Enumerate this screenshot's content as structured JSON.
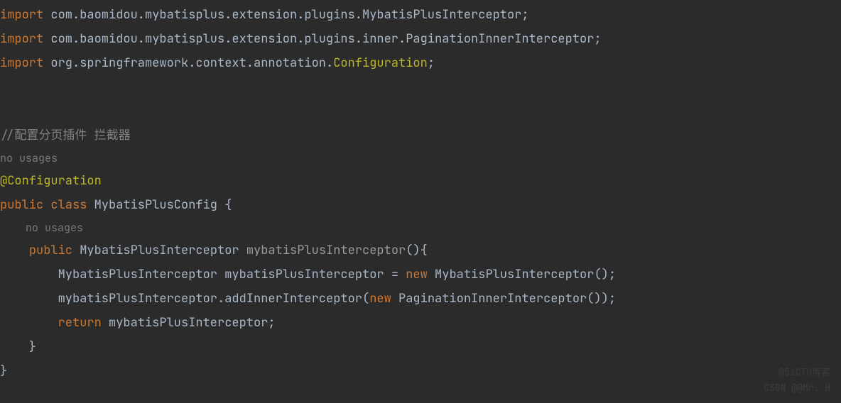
{
  "code": {
    "import_kw": "import",
    "line1_pkg": " com.baomidou.mybatisplus.extension.plugins.MybatisPlusInterceptor;",
    "line2_pkg": " com.baomidou.mybatisplus.extension.plugins.inner.PaginationInnerInterceptor;",
    "line3_pkg_a": " org.springframework.context.annotation.",
    "line3_pkg_b": "Configuration",
    "line3_pkg_c": ";",
    "comment_line": "//配置分页插件 拦截器",
    "no_usages": "no usages",
    "annotation_config": "@Configuration",
    "public_kw": "public",
    "class_kw": "class",
    "class_name": "MybatisPlusConfig",
    "brace_open": " {",
    "method_return_type": "MybatisPlusInterceptor",
    "method_name": "mybatisPlusInterceptor",
    "method_params": "(){",
    "var_type": "MybatisPlusInterceptor",
    "var_name": "mybatisPlusInterceptor",
    "assign": " = ",
    "new_kw": "new",
    "ctor_call": " MybatisPlusInterceptor();",
    "method_call_a": "mybatisPlusInterceptor.addInnerInterceptor(",
    "method_call_b": " PaginationInnerInterceptor());",
    "return_kw": "return",
    "return_val": " mybatisPlusInterceptor;",
    "brace_close_method": "    }",
    "brace_close_class": "}",
    "indent1": "    ",
    "indent2": "        "
  },
  "watermark1": "CSDN @@Mr. H",
  "watermark2": "@51CTO博客"
}
